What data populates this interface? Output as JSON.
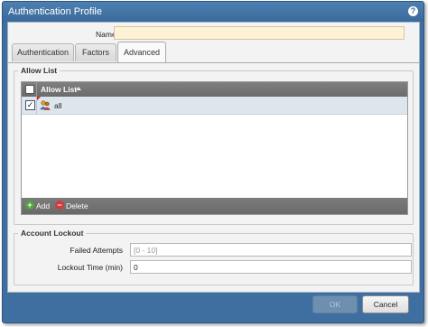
{
  "window": {
    "title": "Authentication Profile",
    "help_icon": "?"
  },
  "form": {
    "name_label": "Name",
    "name_value": ""
  },
  "tabs": [
    {
      "label": "Authentication",
      "active": false
    },
    {
      "label": "Factors",
      "active": false
    },
    {
      "label": "Advanced",
      "active": true
    }
  ],
  "allow_list": {
    "title": "Allow List",
    "column_header": "Allow List",
    "rows": [
      {
        "label": "all",
        "checked": true,
        "check_mark": "✓",
        "icon": "users-icon"
      }
    ],
    "add_label": "Add",
    "add_icon": "+",
    "delete_label": "Delete",
    "delete_icon": "−"
  },
  "account_lockout": {
    "title": "Account Lockout",
    "failed_attempts_label": "Failed Attempts",
    "failed_attempts_placeholder": "[0 - 10]",
    "lockout_time_label": "Lockout Time (min)",
    "lockout_time_value": "0"
  },
  "buttons": {
    "ok": "OK",
    "cancel": "Cancel"
  },
  "colors": {
    "accent": "#3f6fa1",
    "name_field_bg": "#fdf1d6",
    "grid_header": "#737373"
  }
}
